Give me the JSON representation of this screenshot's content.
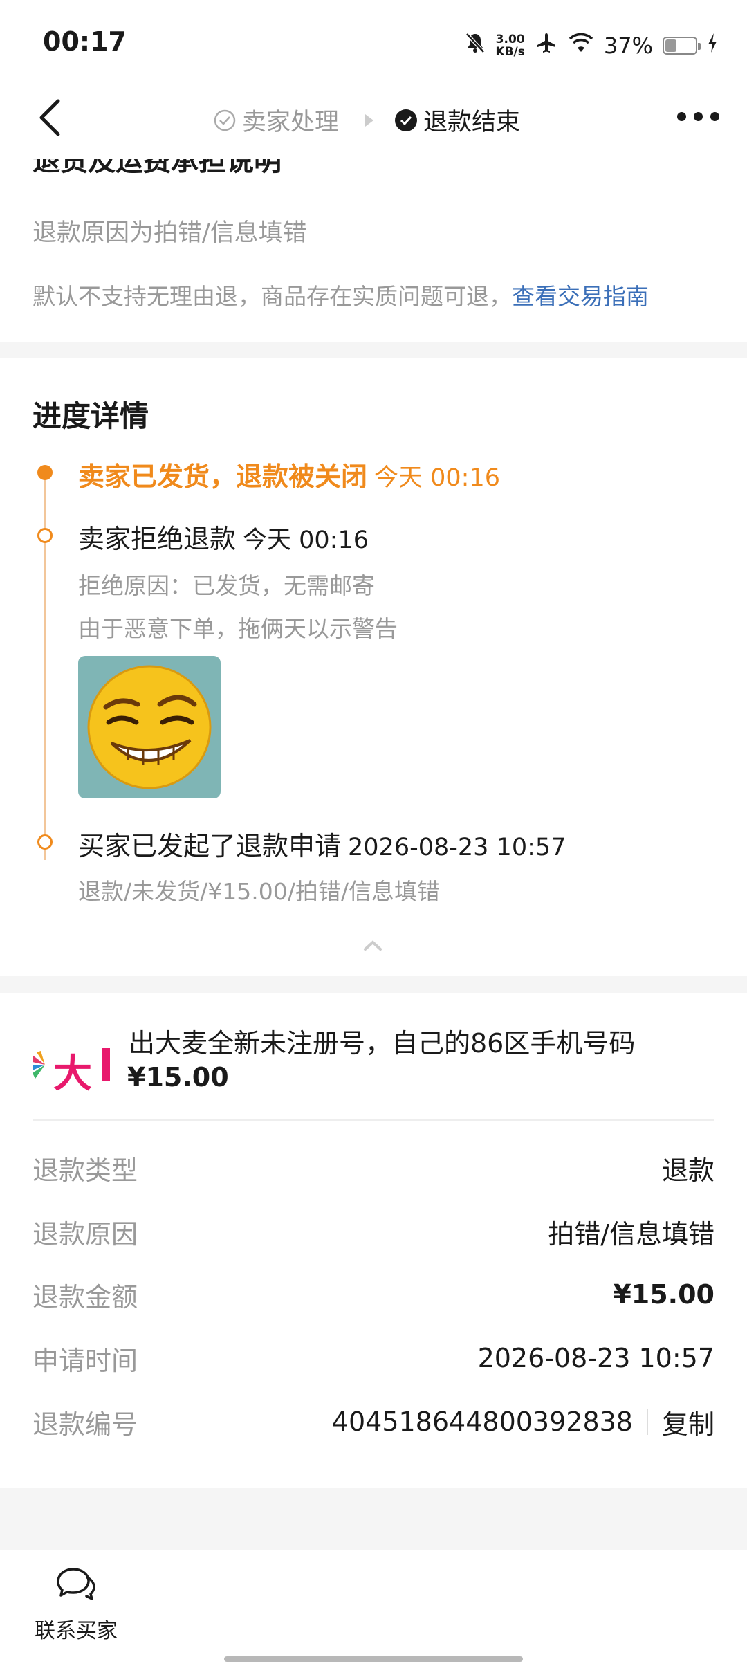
{
  "status_bar": {
    "time": "00:17",
    "net_speed_value": "3.00",
    "net_speed_unit": "KB/s",
    "battery_percent": "37%",
    "battery_level": 0.37
  },
  "nav": {
    "step1": "卖家处理",
    "step2": "退款结束"
  },
  "return_section": {
    "title": "退货及运费承担说明",
    "reason": "退款原因为拍错/信息填错",
    "policy_text": "默认不支持无理由退，商品存在实质问题可退，",
    "policy_link": "查看交易指南"
  },
  "progress": {
    "title": "进度详情",
    "events": [
      {
        "title": "卖家已发货，退款被关闭",
        "time": "今天 00:16"
      },
      {
        "title": "卖家拒绝退款",
        "time": "今天 00:16",
        "detail1": "拒绝原因：已发货，无需邮寄",
        "detail2": "由于恶意下单，拖俩天以示警告"
      },
      {
        "title": "买家已发起了退款申请",
        "time": "2026-08-23 10:57",
        "detail1": "退款/未发货/¥15.00/拍错/信息填错"
      }
    ]
  },
  "product": {
    "thumb_text": "大",
    "title": "出大麦全新未注册号，自己的86区手机号码",
    "price": "¥15.00"
  },
  "refund_info": {
    "type_label": "退款类型",
    "type_value": "退款",
    "reason_label": "退款原因",
    "reason_value": "拍错/信息填错",
    "amount_label": "退款金额",
    "amount_value": "¥15.00",
    "time_label": "申请时间",
    "time_value": "2026-08-23 10:57",
    "id_label": "退款编号",
    "id_value": "404518644800392838",
    "copy_label": "复制"
  },
  "bottom": {
    "contact_label": "联系买家"
  },
  "colors": {
    "accent_orange": "#f08a1c",
    "link_blue": "#3b6fb8",
    "muted": "#999999"
  }
}
